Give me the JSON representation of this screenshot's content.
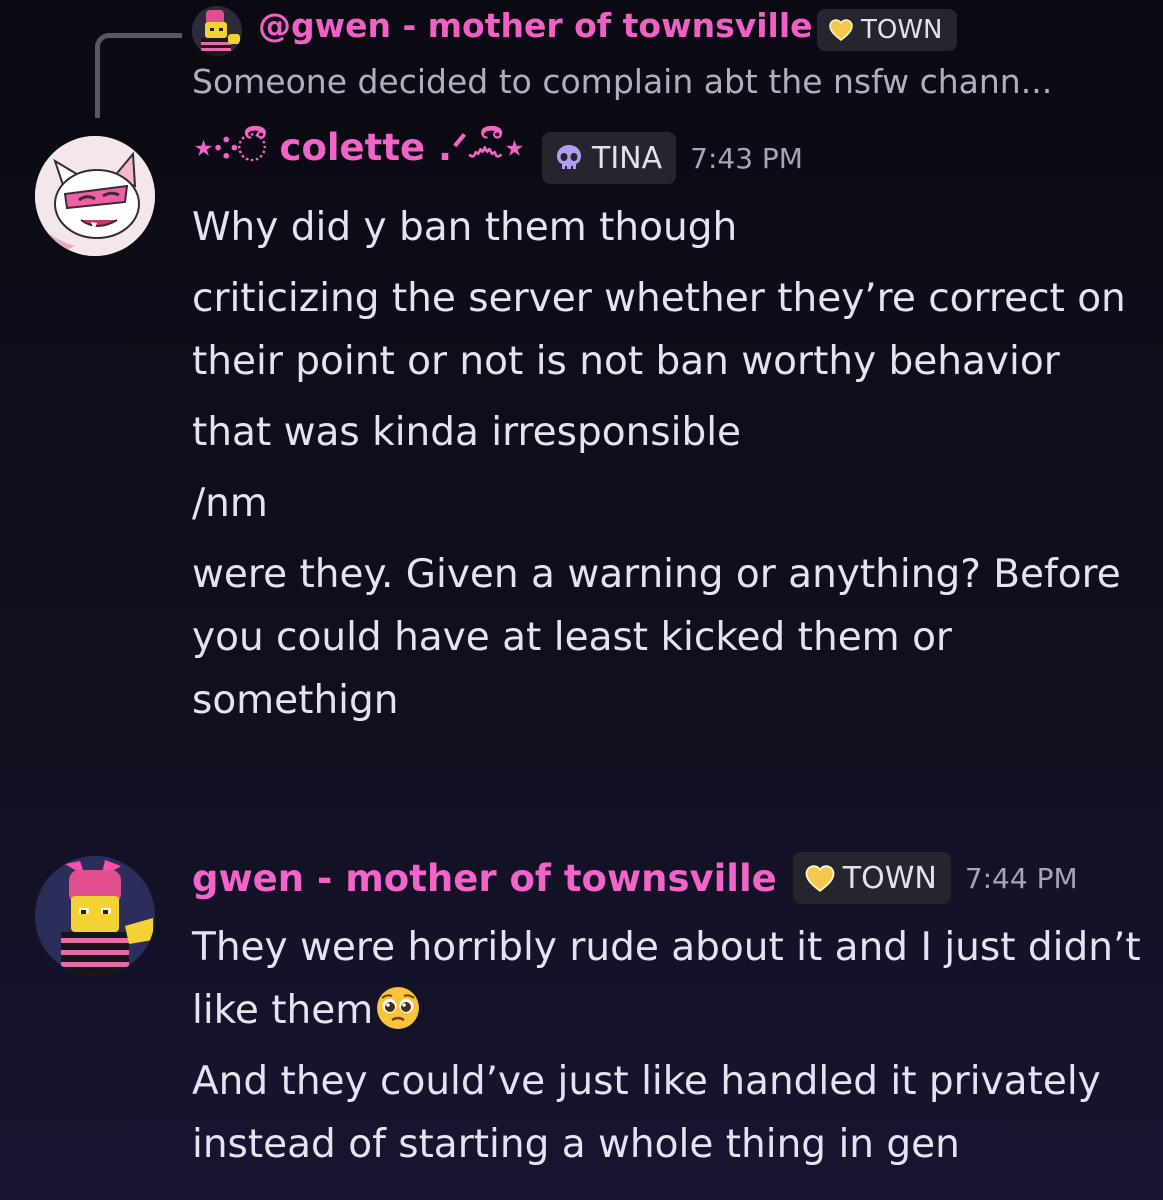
{
  "reply": {
    "author": "@gwen - mother of townsville",
    "role": "TOWN",
    "preview": "Someone decided to complain abt the nsfw chann..."
  },
  "messages": [
    {
      "author": "⋆༶ී colette .ᐟ෴ී⋆",
      "role": "TINA",
      "role_icon": "skull-icon",
      "time": "7:43 PM",
      "lines": [
        "Why did y ban them though",
        "criticizing the server whether they’re correct on their point or not is not ban worthy behavior",
        "that was kinda irresponsible",
        "/nm",
        "were they. Given a warning or anything? Before you could have at least kicked them or somethign"
      ]
    },
    {
      "author": "gwen - mother of townsville",
      "role": "TOWN",
      "role_icon": "heart-icon",
      "time": "7:44 PM",
      "lines": [
        "They were horribly rude about it and I just didn’t like them",
        "And they could’ve just like handled it privately instead of starting a whole thing in gen"
      ]
    }
  ],
  "colors": {
    "author": "#f264c9",
    "role_tag_bg": "#26252e",
    "heart": "#f4c84a",
    "skull": "#b49cf0"
  }
}
